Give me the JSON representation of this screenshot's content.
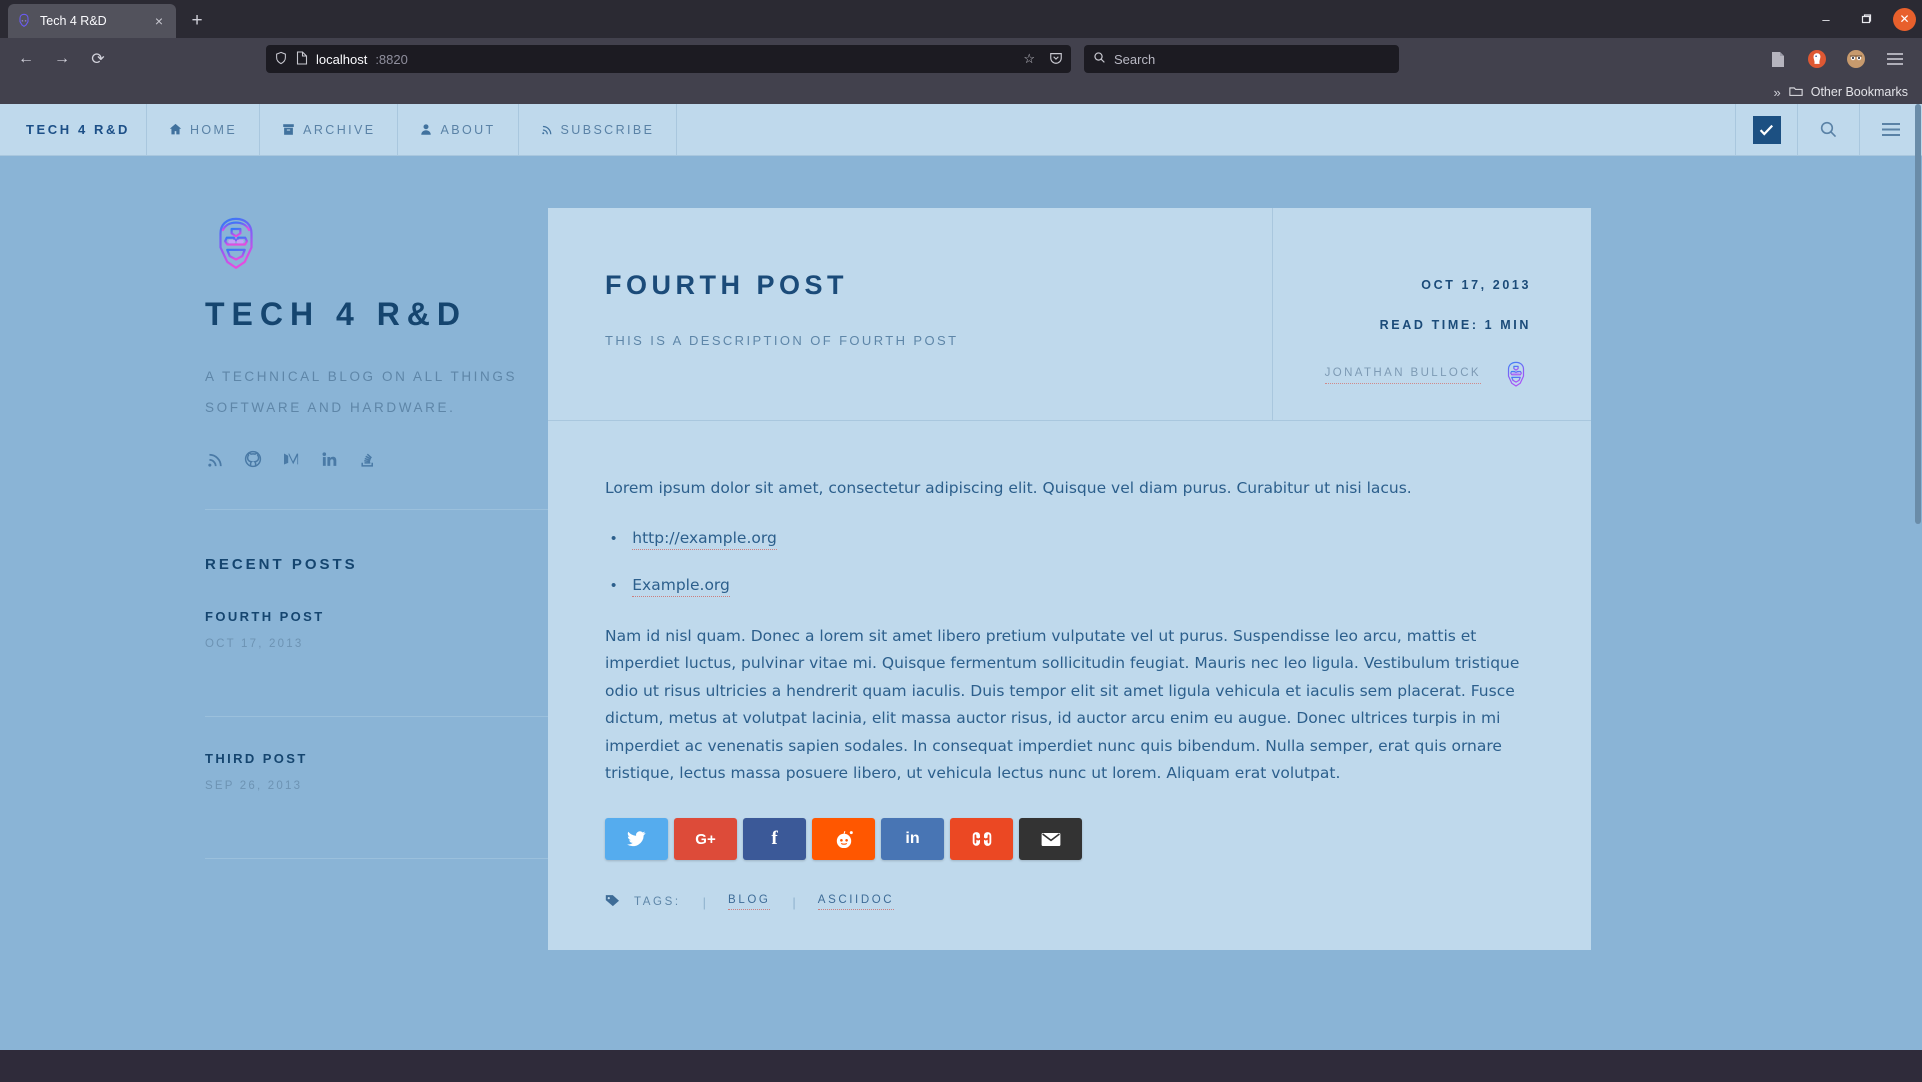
{
  "browser": {
    "tab": {
      "title": "Tech 4 R&D",
      "favicon": "ironman-favicon",
      "close": "×"
    },
    "newtab_label": "+",
    "window_controls": {
      "minimize": "–",
      "maximize": "❐",
      "close": "✕"
    },
    "nav": {
      "back": "←",
      "forward": "→",
      "reload": "⟳"
    },
    "url": {
      "host": "localhost",
      "port": ":8820",
      "shield_icon": "shield-icon",
      "page-icon": "page-icon",
      "bookmark_star": "☆",
      "pocket": "◇"
    },
    "search": {
      "placeholder": "Search",
      "icon": "search-icon"
    },
    "toolbar_icons": [
      "reader-icon",
      "duckduckgo-icon",
      "account-avatar-icon",
      "hamburger-menu-icon"
    ],
    "bookmarks": {
      "overflow": "»",
      "folder_icon": "folder-icon",
      "label": "Other Bookmarks"
    }
  },
  "site": {
    "brand": "TECH 4 R&D",
    "nav_items": [
      {
        "label": "HOME",
        "icon": "home-icon",
        "glyph": "⌂"
      },
      {
        "label": "ARCHIVE",
        "icon": "archive-icon",
        "glyph": "὜4"
      },
      {
        "label": "ABOUT",
        "icon": "user-icon",
        "glyph": "♟"
      },
      {
        "label": "SUBSCRIBE",
        "icon": "rss-icon",
        "glyph": "≋"
      }
    ],
    "nav_right": [
      {
        "name": "theme-toggle-checkbox",
        "glyph": "✔"
      },
      {
        "name": "search-icon",
        "glyph": "⚲"
      },
      {
        "name": "menu-icon",
        "glyph": "☰"
      }
    ]
  },
  "sidebar": {
    "logo": "ironman-logo",
    "title": "TECH 4 R&D",
    "description": "A TECHNICAL BLOG ON ALL THINGS SOFTWARE AND HARDWARE.",
    "social": [
      {
        "name": "rss-icon",
        "label": "RSS"
      },
      {
        "name": "github-icon",
        "label": "GitHub"
      },
      {
        "name": "medium-icon",
        "label": "Medium"
      },
      {
        "name": "linkedin-icon",
        "label": "LinkedIn"
      },
      {
        "name": "stackoverflow-icon",
        "label": "Stack Overflow"
      }
    ],
    "recent_heading": "RECENT POSTS",
    "recent_posts": [
      {
        "title": "FOURTH POST",
        "date": "OCT 17, 2013"
      },
      {
        "title": "THIRD POST",
        "date": "SEP 26, 2013"
      }
    ]
  },
  "article": {
    "title": "FOURTH POST",
    "description": "THIS IS A DESCRIPTION OF FOURTH POST",
    "date": "OCT 17, 2013",
    "read_time": "READ TIME: 1 MIN",
    "author": "JONATHAN BULLOCK",
    "author_avatar": "ironman-avatar",
    "paragraph_1": "Lorem ipsum dolor sit amet, consectetur adipiscing elit. Quisque vel diam purus. Curabitur ut nisi lacus.",
    "links": [
      {
        "text": "http://example.org"
      },
      {
        "text": "Example.org"
      }
    ],
    "paragraph_2": "Nam id nisl quam. Donec a lorem sit amet libero pretium vulputate vel ut purus. Suspendisse leo arcu, mattis et imperdiet luctus, pulvinar vitae mi. Quisque fermentum sollicitudin feugiat. Mauris nec leo ligula. Vestibulum tristique odio ut risus ultricies a hendrerit quam iaculis. Duis tempor elit sit amet ligula vehicula et iaculis sem placerat. Fusce dictum, metus at volutpat lacinia, elit massa auctor risus, id auctor arcu enim eu augue. Donec ultrices turpis in mi imperdiet ac venenatis sapien sodales. In consequat imperdiet nunc quis bibendum. Nulla semper, erat quis ornare tristique, lectus massa posuere libero, ut vehicula lectus nunc ut lorem. Aliquam erat volutpat.",
    "share_buttons": [
      {
        "name": "twitter-share-button",
        "glyph": "🐦",
        "color": "#55acee"
      },
      {
        "name": "googleplus-share-button",
        "glyph": "G+",
        "color": "#dd4b39"
      },
      {
        "name": "facebook-share-button",
        "glyph": "f",
        "color": "#3b5998"
      },
      {
        "name": "reddit-share-button",
        "glyph": "Ⓡ",
        "color": "#ff5700"
      },
      {
        "name": "linkedin-share-button",
        "glyph": "in",
        "color": "#4875b4"
      },
      {
        "name": "stumbleupon-share-button",
        "glyph": "୪",
        "color": "#eb4823"
      },
      {
        "name": "email-share-button",
        "glyph": "✉",
        "color": "#333333"
      }
    ],
    "tags_label": "TAGS:",
    "tags": [
      "BLOG",
      "ASCIIDOC"
    ],
    "tag_separator": "|"
  },
  "colors": {
    "page_bg": "#8ab4d6",
    "panel_bg": "#bfd9ec",
    "heading": "#15456f",
    "muted": "#5e86a8",
    "accent_link_underline": "#cc7f7f"
  }
}
